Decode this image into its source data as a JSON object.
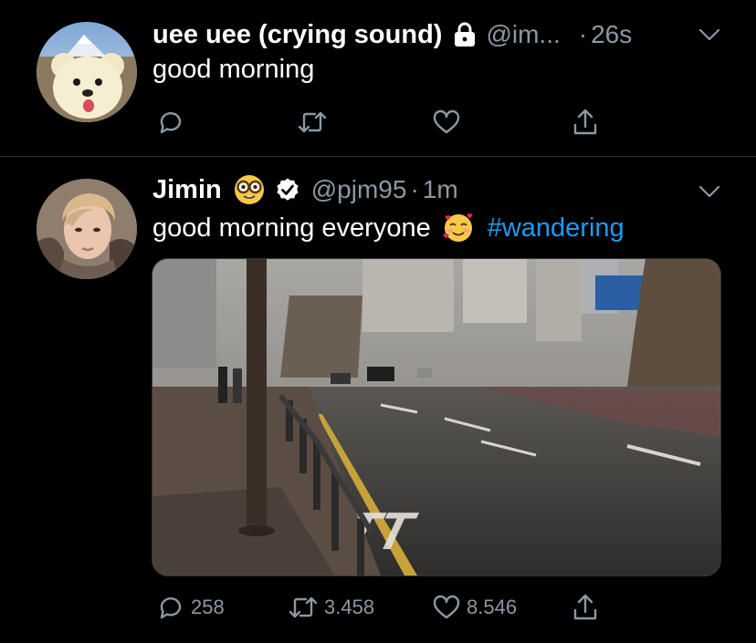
{
  "tweets": [
    {
      "name": "uee uee (crying sound)",
      "handle": "@im...",
      "separator": "·",
      "time": "26s",
      "text": "good morning",
      "reply_count": "",
      "retweet_count": "",
      "like_count": "",
      "protected": true
    },
    {
      "name": "Jimin",
      "handle": "@pjm95",
      "separator": "·",
      "time": "1m",
      "text": "good morning everyone",
      "hashtag": "#wandering",
      "reply_count": "258",
      "retweet_count": "3.458",
      "like_count": "8.546",
      "verified": true
    }
  ],
  "colors": {
    "background": "#000000",
    "secondary_text": "#8b98a5",
    "link": "#1d9bf0",
    "divider": "#2f3336"
  },
  "icons": [
    "lock-icon",
    "chevron-down-icon",
    "reply-icon",
    "retweet-icon",
    "like-icon",
    "share-icon",
    "verified-badge-icon",
    "nerd-face-emoji",
    "smiling-face-with-hearts-emoji"
  ]
}
